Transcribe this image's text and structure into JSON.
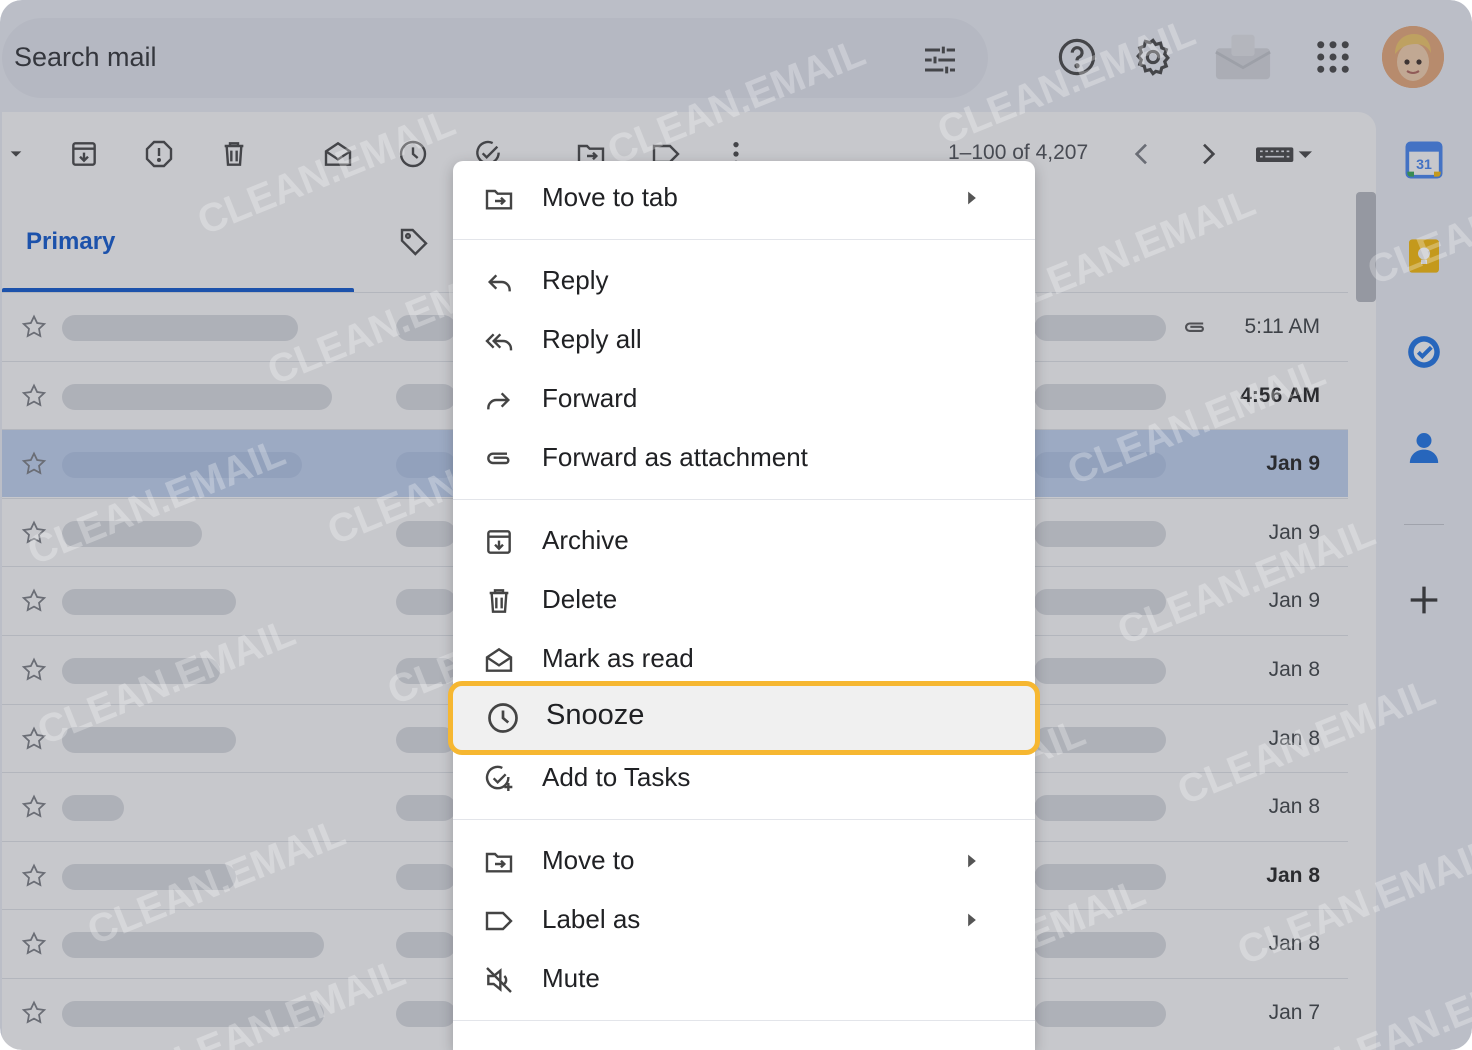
{
  "search": {
    "placeholder": "Search mail"
  },
  "toolbar": {
    "page_info": "1–100 of 4,207"
  },
  "tabs": {
    "primary": "Primary"
  },
  "rows": [
    {
      "date": "5:11 AM",
      "bold": false,
      "selected": false,
      "attachment": true
    },
    {
      "date": "4:56 AM",
      "bold": true,
      "selected": false,
      "attachment": false
    },
    {
      "date": "Jan 9",
      "bold": true,
      "selected": true,
      "attachment": false
    },
    {
      "date": "Jan 9",
      "bold": false,
      "selected": false,
      "attachment": false
    },
    {
      "date": "Jan 9",
      "bold": false,
      "selected": false,
      "attachment": false
    },
    {
      "date": "Jan 8",
      "bold": false,
      "selected": false,
      "attachment": false
    },
    {
      "date": "Jan 8",
      "bold": false,
      "selected": false,
      "attachment": false
    },
    {
      "date": "Jan 8",
      "bold": false,
      "selected": false,
      "attachment": false
    },
    {
      "date": "Jan 8",
      "bold": true,
      "selected": false,
      "attachment": false
    },
    {
      "date": "Jan 8",
      "bold": false,
      "selected": false,
      "attachment": false
    },
    {
      "date": "Jan 7",
      "bold": false,
      "selected": false,
      "attachment": false
    }
  ],
  "menu": {
    "move_to_tab": "Move to tab",
    "reply": "Reply",
    "reply_all": "Reply all",
    "forward": "Forward",
    "forward_attachment": "Forward as attachment",
    "archive": "Archive",
    "delete": "Delete",
    "mark_read": "Mark as read",
    "snooze": "Snooze",
    "add_tasks": "Add to Tasks",
    "move_to": "Move to",
    "label_as": "Label as",
    "mute": "Mute"
  },
  "rail": {
    "calendar_day": "31"
  },
  "watermark": "CLEAN.EMAIL",
  "colors": {
    "accent": "#0b57d0",
    "highlight": "#f6b731",
    "selected_row": "#c2d4f2"
  }
}
